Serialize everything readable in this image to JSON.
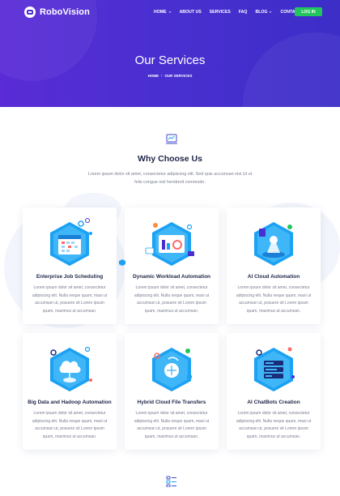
{
  "header": {
    "logo_text": "RoboVision",
    "nav": [
      {
        "label": "HOME",
        "has_caret": true
      },
      {
        "label": "ABOUT US",
        "has_caret": false
      },
      {
        "label": "SERVICES",
        "has_caret": false
      },
      {
        "label": "FAQ",
        "has_caret": false
      },
      {
        "label": "BLOG",
        "has_caret": true
      },
      {
        "label": "CONTACT",
        "has_caret": false
      }
    ],
    "login_label": "LOG IN"
  },
  "hero": {
    "title": "Our Services",
    "breadcrumb": [
      "HOME",
      "OUR SERVICES"
    ]
  },
  "section": {
    "title": "Why Choose Us",
    "description": "Lorem ipsum dolor sit amet, consectetur adipiscing elit. Sed quis accumsan nisi Ut ut felis congue nisl hendrerit commodo."
  },
  "services": [
    {
      "title": "Enterprise Job Scheduling",
      "description": "Lorem ipsum dolor sit amet, consectetur adipiscing elit. Nulla neque quam, maxi ut accumsan ut, posuere sit Lorem ipsum quam, maximus ut accumsan."
    },
    {
      "title": "Dynamic Workload Automation",
      "description": "Lorem ipsum dolor sit amet, consectetur adipiscing elit. Nulla neque quam, maxi ut accumsan ut, posuere sit Lorem ipsum quam, maximus ut accumsan."
    },
    {
      "title": "AI Cloud Automation",
      "description": "Lorem ipsum dolor sit amet, consectetur adipiscing elit. Nulla neque quam, maxi ut accumsan ut, posuere sit Lorem ipsum quam, maximus ut accumsan."
    },
    {
      "title": "Big Data and Hadoop Automation",
      "description": "Lorem ipsum dolor sit amet, consectetur adipiscing elit. Nulla neque quam, maxi ut accumsan ut, posuere sit Lorem ipsum quam, maximus ut accumsan."
    },
    {
      "title": "Hybrid Cloud File Transfers",
      "description": "Lorem ipsum dolor sit amet, consectetur adipiscing elit. Nulla neque quam, maxi ut accumsan ut, posuere sit Lorem ipsum quam, maximus ut accumsan."
    },
    {
      "title": "AI ChatBots Creation",
      "description": "Lorem ipsum dolor sit amet, consectetur adipiscing elit. Nulla neque quam, maxi ut accumsan ut, posuere sit Lorem ipsum quam, maximus ut accumsan."
    }
  ],
  "icons": {
    "section_icon": "chart-window-icon",
    "bottom_icon": "checklist-icon"
  },
  "colors": {
    "hero_start": "#5a2bd6",
    "hero_end": "#3d2ec8",
    "login_button": "#22c55e",
    "heading": "#1e2547",
    "body_text": "#7a7f92",
    "illustration_blue": "#1da1f2"
  }
}
